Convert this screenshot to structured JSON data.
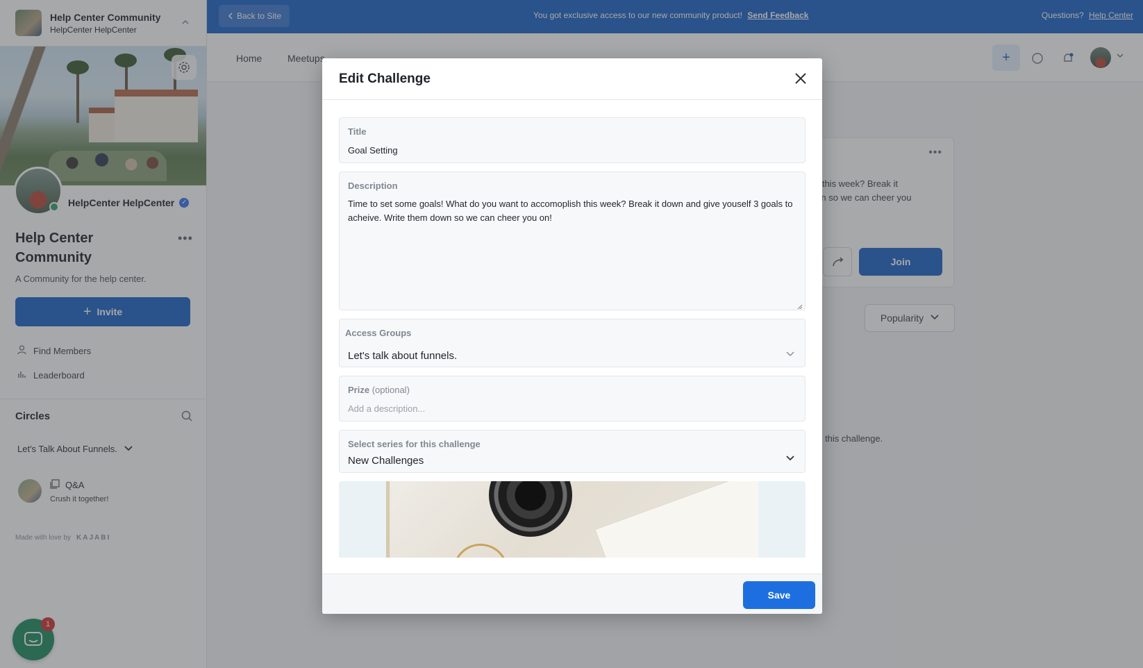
{
  "sidebar": {
    "community_name": "Help Center Community",
    "community_owner": "HelpCenter HelpCenter",
    "owner_display_name": "HelpCenter HelpCenter",
    "title": "Help Center Community",
    "description": "A Community for the help center.",
    "invite_label": "Invite",
    "links": [
      {
        "label": "Find Members",
        "icon": "person-icon"
      },
      {
        "label": "Leaderboard",
        "icon": "bar-chart-icon"
      }
    ],
    "circles_heading": "Circles",
    "circle_group": "Let's Talk About Funnels.",
    "circle_item": {
      "title": "Q&A",
      "subtitle": "Crush it together!"
    },
    "made_with": "Made with love by",
    "brand": "KAJABI",
    "chat_badge": "1"
  },
  "banner": {
    "back_label": "Back to Site",
    "message": "You got exclusive access to our new community product!",
    "feedback_link": "Send Feedback",
    "questions": "Questions?",
    "help_link": "Help Center",
    "color": "#1d63c7"
  },
  "nav": {
    "items": [
      "Home",
      "Meetups"
    ],
    "plus": "+"
  },
  "background": {
    "card_text": "h this week? Break it\nwn so we can cheer you",
    "join_label": "Join",
    "sort_label": "Popularity",
    "hint_text": "ng this challenge."
  },
  "modal": {
    "title": "Edit Challenge",
    "fields": {
      "title_label": "Title",
      "title_value": "Goal Setting",
      "description_label": "Description",
      "description_value": "Time to set some goals! What do you want to accomoplish this week? Break it down and give youself 3 goals to acheive. Write them down so we can cheer you on!",
      "access_label": "Access Groups",
      "access_value": "Let's talk about funnels.",
      "prize_label": "Prize",
      "prize_optional": "(optional)",
      "prize_placeholder": "Add a description...",
      "series_label": "Select series for this challenge",
      "series_value": "New Challenges"
    },
    "save_label": "Save"
  }
}
